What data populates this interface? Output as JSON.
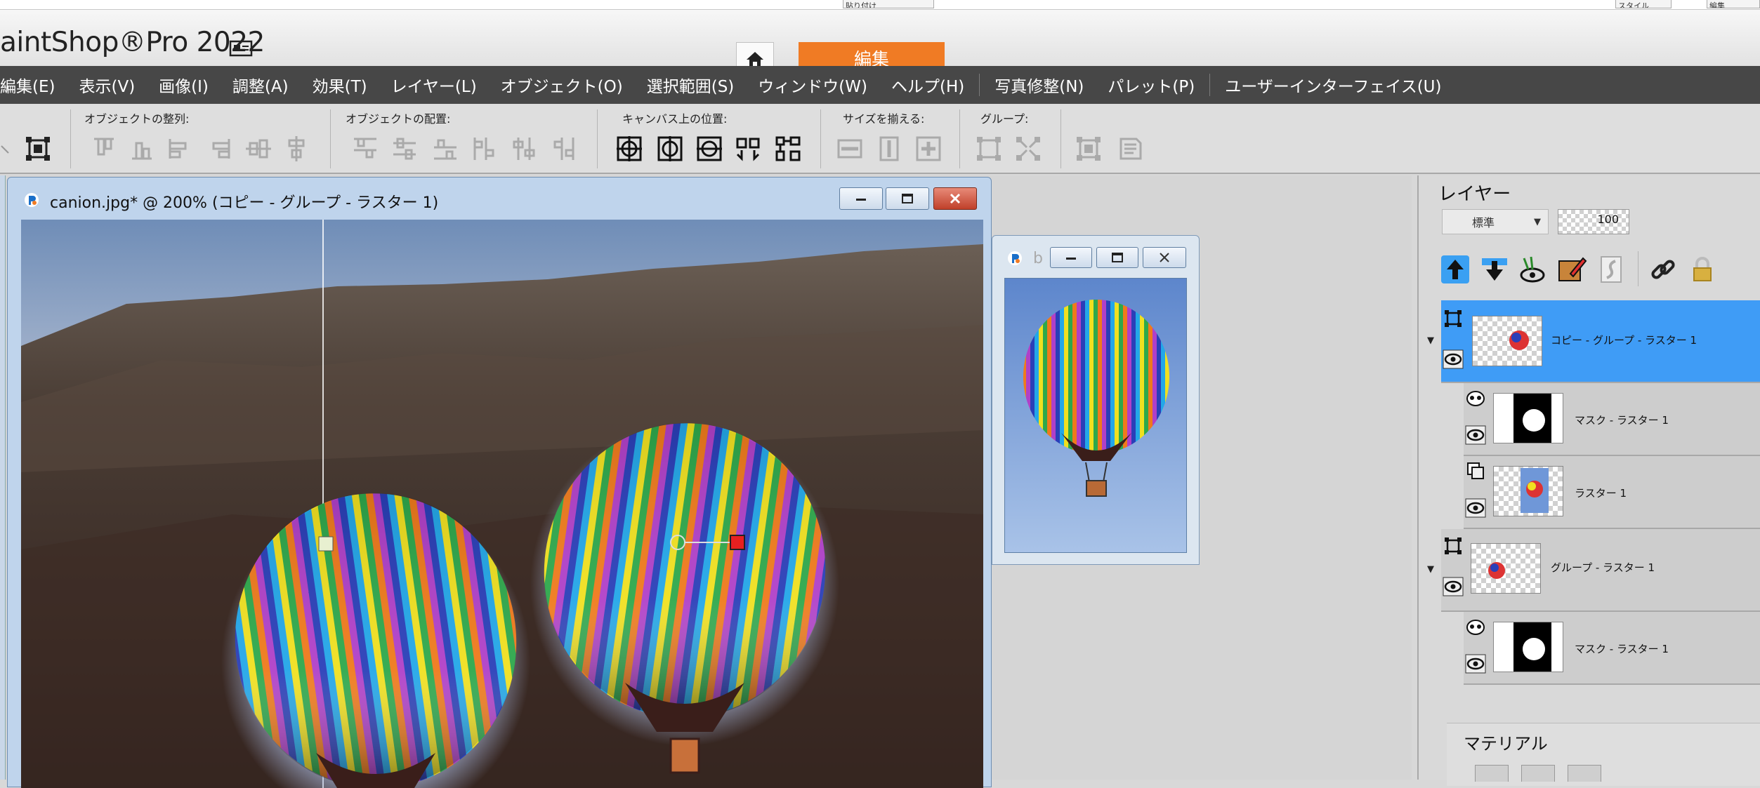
{
  "app": {
    "title": "aintShop®Pro 2022",
    "top_fragments": [
      "貼り付け",
      "スタイル",
      "編集"
    ]
  },
  "tabs": {
    "edit_label": "編集"
  },
  "menu": {
    "items": [
      "編集(E)",
      "表示(V)",
      "画像(I)",
      "調整(A)",
      "効果(T)",
      "レイヤー(L)",
      "オブジェクト(O)",
      "選択範囲(S)",
      "ウィンドウ(W)",
      "ヘルプ(H)"
    ],
    "extra_items": [
      "写真修整(N)",
      "パレット(P)",
      "ユーザーインターフェイス(U)"
    ]
  },
  "toolbar": {
    "groups": [
      {
        "label": "オブジェクトの整列:"
      },
      {
        "label": "オブジェクトの配置:"
      },
      {
        "label": "キャンバス上の位置:"
      },
      {
        "label": "サイズを揃える:"
      },
      {
        "label": "グループ:"
      }
    ]
  },
  "document": {
    "title": "canion.jpg* @ 200% (コピー - グループ - ラスター 1)"
  },
  "preview": {
    "title": "b"
  },
  "layers": {
    "title": "レイヤー",
    "blend_mode": "標準",
    "opacity": "100",
    "items": [
      {
        "name": "コピー - グループ - ラスター 1",
        "selected": true
      },
      {
        "name": "マスク - ラスター 1"
      },
      {
        "name": "ラスター 1"
      },
      {
        "name": "グループ - ラスター 1"
      },
      {
        "name": "マスク - ラスター 1"
      }
    ]
  },
  "materials": {
    "title": "マテリアル"
  },
  "colors": {
    "accent": "#f07b24",
    "menubar": "#474747",
    "selection": "#3f9cf6"
  }
}
